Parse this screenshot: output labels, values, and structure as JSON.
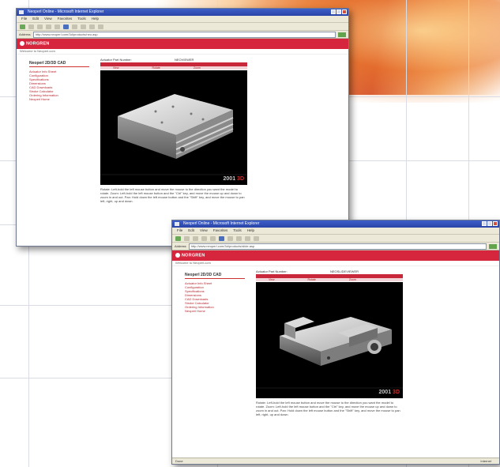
{
  "window1": {
    "title": "Neoperl Online - Microsoft Internet Explorer",
    "menu": [
      "File",
      "Edit",
      "View",
      "Favorites",
      "Tools",
      "Help"
    ],
    "address_label": "Address",
    "url": "http://www.neoperl.com/3d/products/neo.asp",
    "go_label": "Go",
    "logo": "NORGREN",
    "welcome": "Welcome to Neoperl.com",
    "product_title": "Neoperl 2D/3D CAD",
    "product_header_left": "Actuator Part Number:",
    "product_header_right": "NEOVIEWER",
    "tab_labels": [
      "View",
      "Rotate",
      "Zoom"
    ],
    "sidebar_links": [
      "Actuator Info Sheet",
      "Configuration",
      "Specifications",
      "Dimensions",
      "CAD Downloads",
      "Stroke Calculator",
      "Ordering Information",
      "Neoperl Home"
    ],
    "watermark_a": "2001",
    "watermark_b": "3D",
    "caption": "Rotate: Left-hold the left mouse button and move the mouse to the direction you want the model to rotate. Zoom: Left-hold the left mouse button and the \"Ctrl\" key, and move the mouse up and down to zoom in and out. Pan: Hold down the left mouse button and the \"Shift\" key, and move the mouse to pan left, right, up and down."
  },
  "window2": {
    "title": "Neoperl Online - Microsoft Internet Explorer",
    "menu": [
      "File",
      "Edit",
      "View",
      "Favorites",
      "Tools",
      "Help"
    ],
    "address_label": "Address",
    "url": "http://www.neoperl.com/3d/products/slide.asp",
    "go_label": "Go",
    "logo": "NORGREN",
    "welcome": "Welcome to Neoperl.com",
    "product_title": "Neoperl 2D/3D CAD",
    "product_header_left": "Actuator Part Number:",
    "product_header_right": "NEOSLIDEVIEWER",
    "tab_labels": [
      "View",
      "Rotate",
      "Zoom"
    ],
    "sidebar_links": [
      "Actuator Info Sheet",
      "Configuration",
      "Specifications",
      "Dimensions",
      "CAD Downloads",
      "Stroke Calculator",
      "Ordering Information",
      "Neoperl Home"
    ],
    "watermark_a": "2001",
    "watermark_b": "3D",
    "caption": "Rotate: Left-hold the left mouse button and move the mouse to the direction you want the model to rotate. Zoom: Left-hold the left mouse button and the \"Ctrl\" key, and move the mouse up and down to zoom in and out. Pan: Hold down the left mouse button and the \"Shift\" key, and move the mouse to pan left, right, up and down.",
    "status_left": "Done",
    "status_right": "Internet"
  }
}
